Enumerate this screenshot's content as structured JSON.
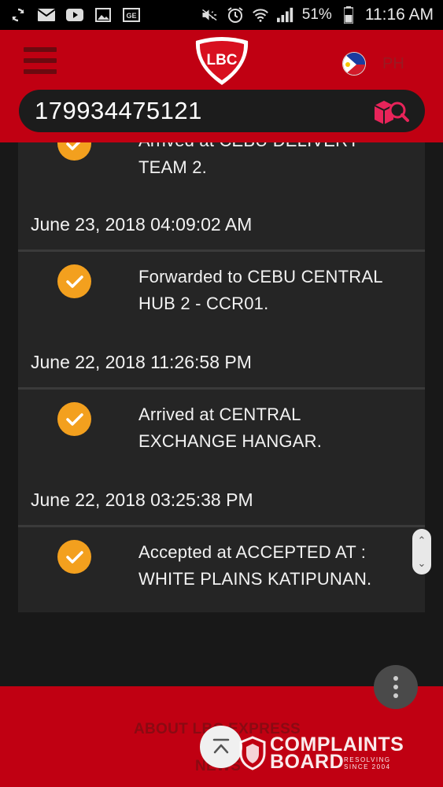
{
  "status_bar": {
    "battery": "51%",
    "time": "11:16 AM",
    "icons": [
      "sync-icon",
      "mail-icon",
      "youtube-icon",
      "gallery-icon",
      "ge-icon",
      "mute-icon",
      "alarm-icon",
      "wifi-icon",
      "signal-icon",
      "battery-icon"
    ]
  },
  "header": {
    "logo_text": "LBC",
    "country": "PH",
    "search_value": "179934475121",
    "colors": {
      "brand_red": "#c00012",
      "accent_orange": "#f3a01e"
    }
  },
  "tracking": {
    "events": [
      {
        "text_line1": "Arrived at CEBU DELIVERY",
        "text_line2": "TEAM 2.",
        "date": "June 23, 2018 04:09:02 AM"
      },
      {
        "text_line1": "Forwarded to CEBU CENTRAL",
        "text_line2": "HUB 2 - CCR01.",
        "date": "June 22, 2018 11:26:58 PM"
      },
      {
        "text_line1": "Arrived at CENTRAL",
        "text_line2": "EXCHANGE HANGAR.",
        "date": "June 22, 2018 03:25:38 PM"
      },
      {
        "text_line1": "Accepted at ACCEPTED AT :",
        "text_line2": "WHITE PLAINS KATIPUNAN.",
        "date": ""
      }
    ]
  },
  "footer": {
    "link_about": "ABOUT LBC EXPRESS",
    "link_news": "NEWS"
  },
  "watermark": {
    "line1": "COMPLAINTS",
    "line2": "BOARD",
    "tag1": "RESOLVING",
    "tag2": "SINCE 2004"
  }
}
